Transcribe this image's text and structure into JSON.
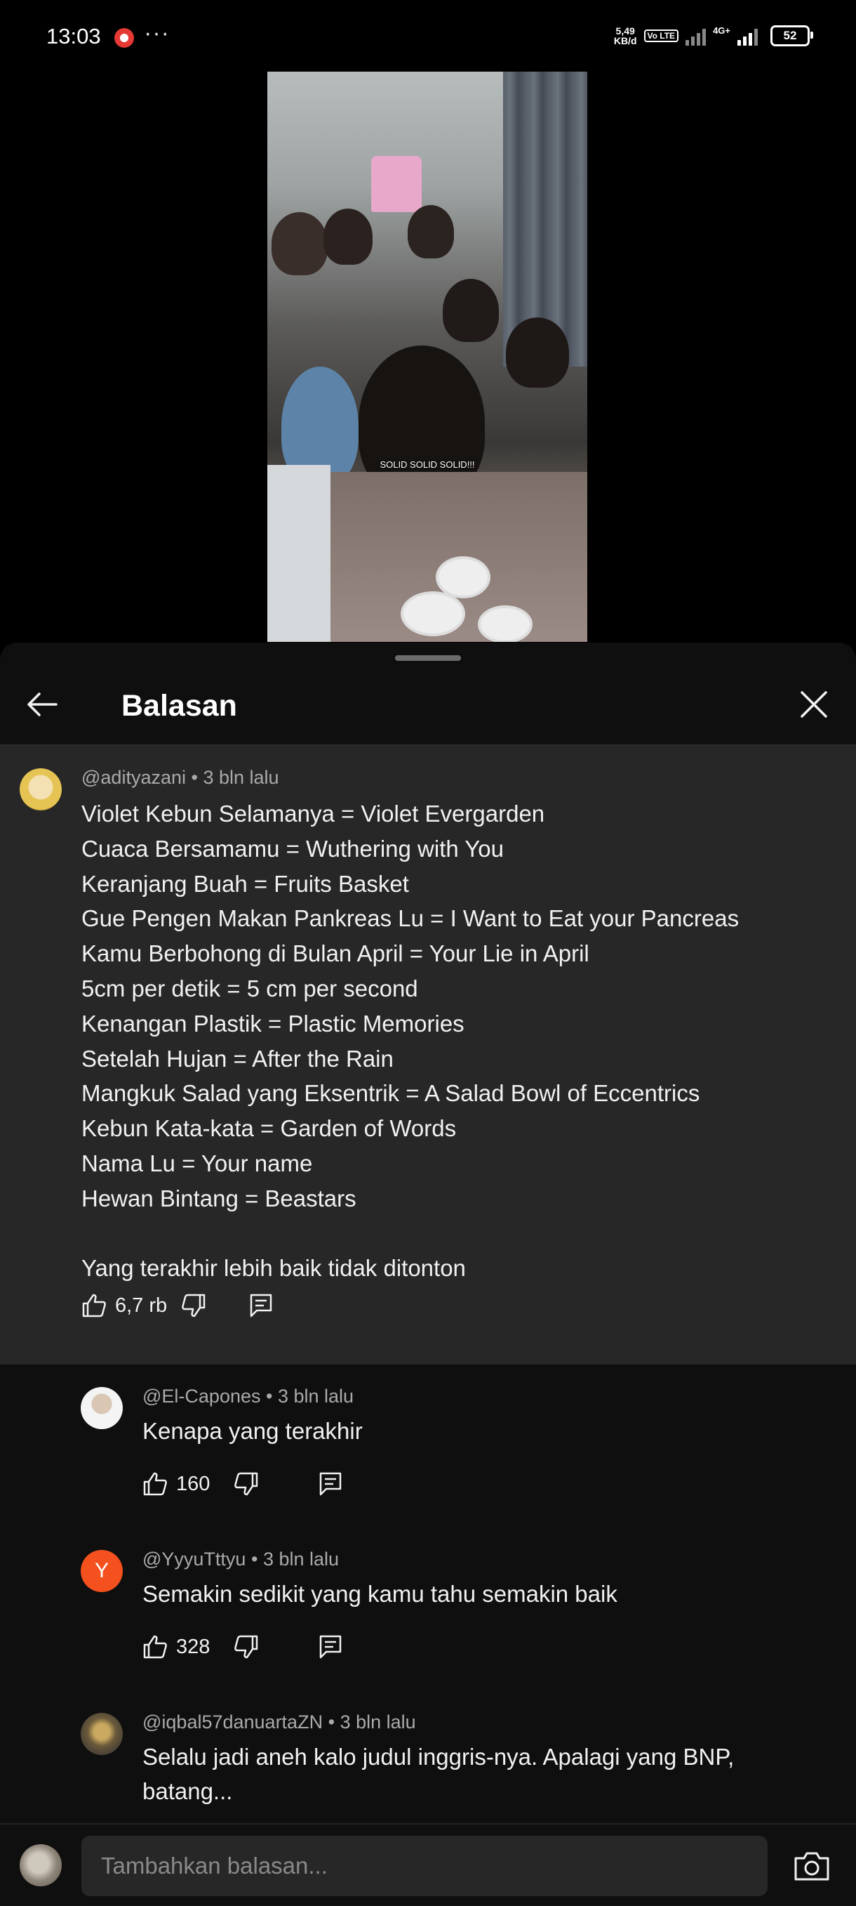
{
  "status_bar": {
    "time": "13:03",
    "speed_value": "5,49",
    "speed_unit": "KB/d",
    "volte": "Vo LTE",
    "network": "4G+",
    "battery": "52"
  },
  "video": {
    "caption": "SOLID SOLID SOLID!!!"
  },
  "sheet": {
    "title": "Balasan"
  },
  "main_comment": {
    "author": "@adityazani",
    "time": "3 bln lalu",
    "lines": [
      "Violet Kebun Selamanya = Violet Evergarden",
      "Cuaca Bersamamu = Wuthering with You",
      "Keranjang Buah = Fruits Basket",
      "Gue Pengen Makan Pankreas Lu = I Want to Eat your Pancreas",
      "Kamu Berbohong di Bulan April = Your Lie in April",
      "5cm per detik = 5 cm per second",
      "Kenangan Plastik = Plastic Memories",
      "Setelah Hujan = After the Rain",
      "Mangkuk Salad yang Eksentrik = A Salad Bowl of Eccentrics",
      "Kebun Kata-kata = Garden of Words",
      "Nama Lu = Your name",
      "Hewan Bintang = Beastars",
      "",
      "Yang terakhir lebih baik tidak ditonton"
    ],
    "likes": "6,7 rb"
  },
  "replies": [
    {
      "author": "@El-Capones",
      "time": "3 bln lalu",
      "text": "Kenapa yang terakhir",
      "likes": "160",
      "avatar_letter": ""
    },
    {
      "author": "@YyyuTttyu",
      "time": "3 bln lalu",
      "text": "Semakin sedikit yang kamu tahu semakin baik",
      "likes": "328",
      "avatar_letter": "Y"
    },
    {
      "author": "@iqbal57danuartaZN",
      "time": "3 bln lalu",
      "text": "Selalu jadi aneh kalo judul inggris-nya. Apalagi yang BNP, batang...",
      "likes": "",
      "avatar_letter": ""
    }
  ],
  "composer": {
    "placeholder": "Tambahkan balasan..."
  },
  "colors": {
    "background": "#0f0f0f",
    "highlight_comment": "#272727",
    "meta_text": "#aaaaaa",
    "avatar_y": "#f4511e"
  },
  "icons": [
    "back-arrow-icon",
    "close-icon",
    "thumbs-up-icon",
    "thumbs-down-icon",
    "reply-icon",
    "camera-icon"
  ]
}
